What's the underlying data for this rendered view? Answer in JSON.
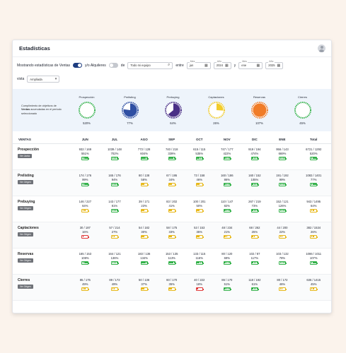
{
  "window": {
    "title": "Estadísticas"
  },
  "filters": {
    "label_show": "Mostrando estadísticas de Ventas",
    "label_and": "y/o Alquileres",
    "label_of": "de",
    "team_value": "Todo mi equipo",
    "label_between": "entre",
    "from_month_label": "Mes",
    "from_month_value": "jun",
    "from_year_label": "Año",
    "from_year_value": "2024",
    "label_y": "y",
    "to_month_label": "Mes",
    "to_month_value": "ene",
    "to_year_label": "Año",
    "to_year_value": "2025",
    "label_view": "vista",
    "view_value": "Ampliada"
  },
  "summary": {
    "caption_pre": "Cumplimiento de objetivos de ",
    "caption_bold": "Ventas",
    "caption_post": " acumuladas en el periodo seleccionado",
    "gauges": [
      {
        "name": "Prospección",
        "value": "520%",
        "pct": 1.0,
        "style": "ring",
        "color": "#34b24a"
      },
      {
        "name": "Prelisting",
        "value": "77%",
        "pct": 0.77,
        "style": "pie",
        "color": "#2f4fa3"
      },
      {
        "name": "Prebuying",
        "value": "64%",
        "pct": 0.64,
        "style": "pie",
        "color": "#4a2f86"
      },
      {
        "name": "Captaciones",
        "value": "26%",
        "pct": 0.26,
        "style": "pie",
        "color": "#f2cc2a"
      },
      {
        "name": "Reservas",
        "value": "107%",
        "pct": 1.0,
        "style": "full",
        "color": "#f07c28"
      },
      {
        "name": "Cierres",
        "value": "45%",
        "pct": 0.45,
        "style": "ring",
        "color": "#34b24a"
      }
    ]
  },
  "table": {
    "headers": [
      "VENTAS",
      "JUN",
      "JUL",
      "AGO",
      "SEP",
      "OCT",
      "NOV",
      "DIC",
      "ENE",
      "Total"
    ],
    "rows": [
      {
        "name": "Prospección",
        "button": "Ver Junta",
        "cells": [
          [
            "932 / 169",
            "551%",
            "green"
          ],
          [
            "1039 / 148",
            "702%",
            "green"
          ],
          [
            "773 / 128",
            "604%",
            "green"
          ],
          [
            "740 / 218",
            "339%",
            "green"
          ],
          [
            "615 / 115",
            "535%",
            "green"
          ],
          [
            "747 / 177",
            "422%",
            "green"
          ],
          [
            "919 / 194",
            "474%",
            "green"
          ],
          [
            "956 / 143",
            "669%",
            "green"
          ],
          [
            "6721 / 1292",
            "520%",
            "green"
          ]
        ]
      },
      {
        "name": "Prelisting",
        "button": "Ver Origen",
        "cells": [
          [
            "174 / 176",
            "99%",
            "green"
          ],
          [
            "165 / 176",
            "94%",
            "green"
          ],
          [
            "80 / 138",
            "58%",
            "yellow"
          ],
          [
            "67 / 195",
            "34%",
            "yellow"
          ],
          [
            "73 / 158",
            "46%",
            "yellow"
          ],
          [
            "160 / 186",
            "86%",
            "green"
          ],
          [
            "160 / 152",
            "105%",
            "green"
          ],
          [
            "191 / 192",
            "99%",
            "green"
          ],
          [
            "1083 / 1401",
            "77%",
            "green"
          ]
        ]
      },
      {
        "name": "Prebuying",
        "button": "Ver Origen",
        "cells": [
          [
            "146 / 227",
            "64%",
            "yellow"
          ],
          [
            "143 / 177",
            "81%",
            "green"
          ],
          [
            "39 / 171",
            "23%",
            "yellow"
          ],
          [
            "83 / 202",
            "41%",
            "yellow"
          ],
          [
            "100 / 201",
            "50%",
            "yellow"
          ],
          [
            "110 / 147",
            "82%",
            "green"
          ],
          [
            "267 / 219",
            "73%",
            "green"
          ],
          [
            "152 / 121",
            "126%",
            "green"
          ],
          [
            "943 / 1495",
            "64%",
            "yellow"
          ]
        ]
      },
      {
        "name": "Captaciones",
        "button": "Ver Origen",
        "cells": [
          [
            "30 / 187",
            "16%",
            "red"
          ],
          [
            "57 / 214",
            "27%",
            "yellow"
          ],
          [
            "54 / 182",
            "30%",
            "yellow"
          ],
          [
            "58 / 175",
            "33%",
            "yellow"
          ],
          [
            "53 / 153",
            "35%",
            "yellow"
          ],
          [
            "48 / 234",
            "21%",
            "yellow"
          ],
          [
            "68 / 262",
            "25%",
            "yellow"
          ],
          [
            "44 / 200",
            "22%",
            "yellow"
          ],
          [
            "382 / 1534",
            "26%",
            "yellow"
          ]
        ]
      },
      {
        "name": "Reservas",
        "button": "Ver Origen",
        "cells": [
          [
            "165 / 153",
            "108%",
            "green"
          ],
          [
            "164 / 121",
            "136%",
            "green"
          ],
          [
            "183 / 136",
            "134%",
            "green"
          ],
          [
            "153 / 135",
            "113%",
            "green"
          ],
          [
            "133 / 115",
            "116%",
            "green"
          ],
          [
            "80 / 120",
            "69%",
            "green"
          ],
          [
            "102 / 87",
            "117%",
            "green"
          ],
          [
            "103 / 132",
            "78%",
            "green"
          ],
          [
            "1086 / 1011",
            "107%",
            "green"
          ]
        ]
      },
      {
        "name": "Cierres",
        "button": "Ver Origen",
        "cells": [
          [
            "85 / 175",
            "49%",
            "yellow"
          ],
          [
            "89 / 172",
            "49%",
            "yellow"
          ],
          [
            "50 / 136",
            "37%",
            "yellow"
          ],
          [
            "60 / 170",
            "35%",
            "yellow"
          ],
          [
            "40 / 222",
            "18%",
            "red"
          ],
          [
            "86 / 170",
            "51%",
            "green"
          ],
          [
            "118 / 192",
            "61%",
            "green"
          ],
          [
            "80 / 172",
            "46%",
            "yellow"
          ],
          [
            "636 / 1415",
            "45%",
            "yellow"
          ]
        ]
      }
    ]
  }
}
